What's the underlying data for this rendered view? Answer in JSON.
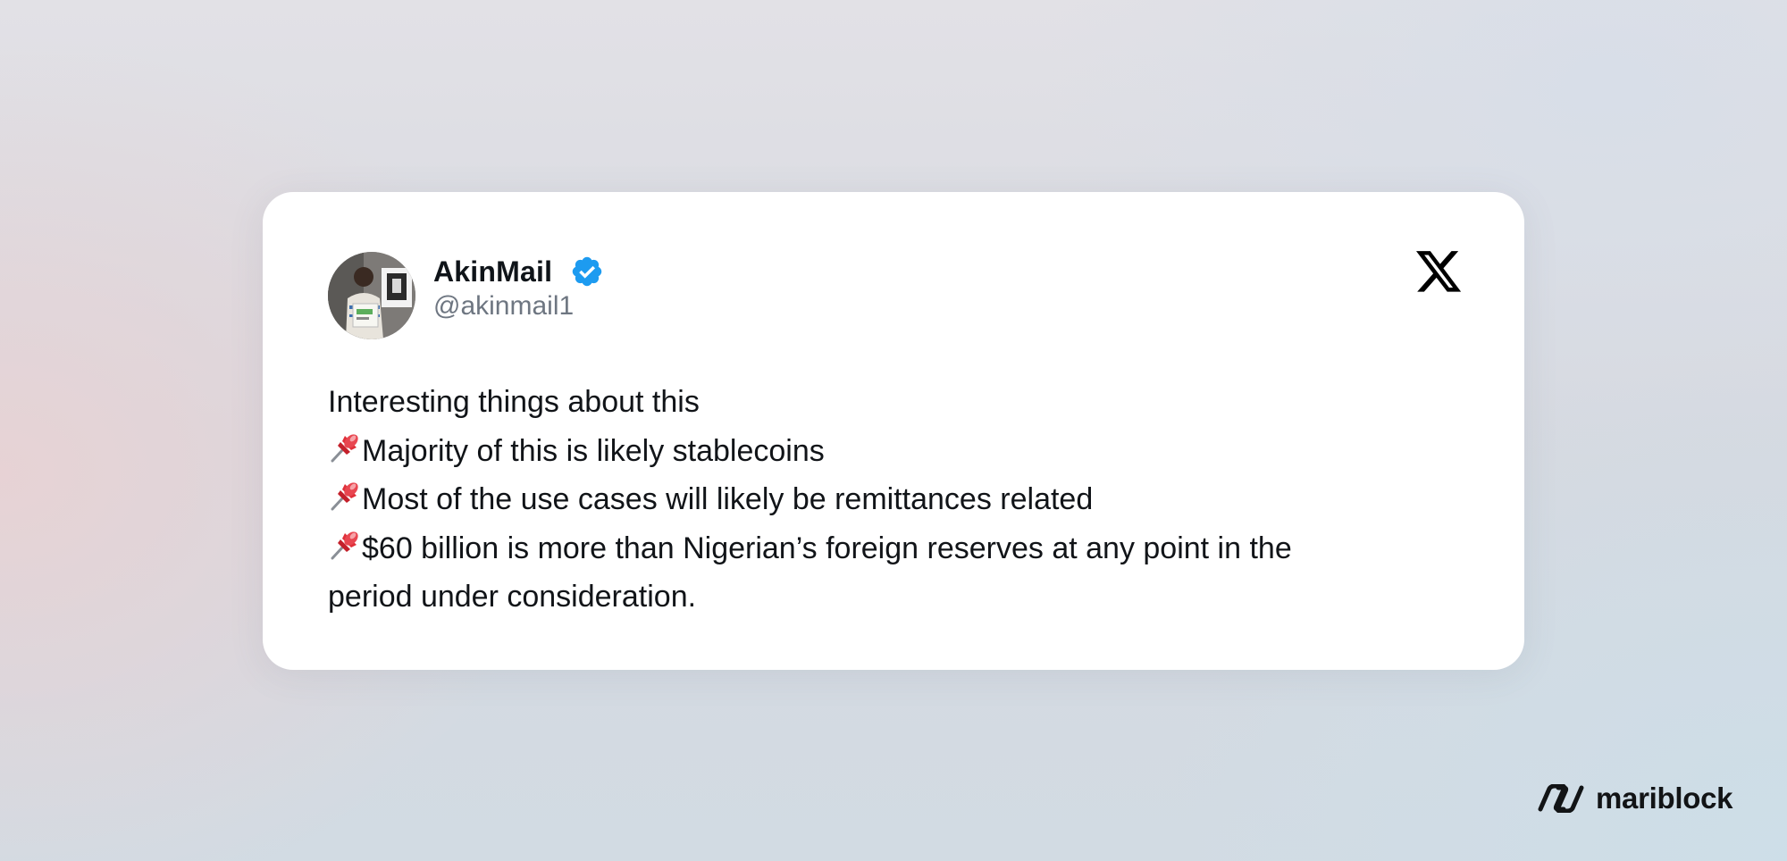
{
  "tweet": {
    "author_name": "AkinMail",
    "handle": "@akinmail1",
    "verified": true,
    "platform_icon": "x-logo-icon",
    "lines": [
      {
        "pin": false,
        "text": "Interesting things about this"
      },
      {
        "pin": true,
        "text": "Majority of this is likely stablecoins"
      },
      {
        "pin": true,
        "text": "Most of the use cases will likely be remittances related"
      },
      {
        "pin": true,
        "text": "$60 billion is more than Nigerian’s foreign reserves at any point in the"
      },
      {
        "pin": false,
        "text": "period under consideration."
      }
    ],
    "colors": {
      "verified_badge": "#1d9bf0",
      "handle_text": "#6e7681",
      "body_text": "#111418"
    }
  },
  "brand": {
    "name": "mariblock",
    "icon": "mariblock-logo-icon"
  }
}
